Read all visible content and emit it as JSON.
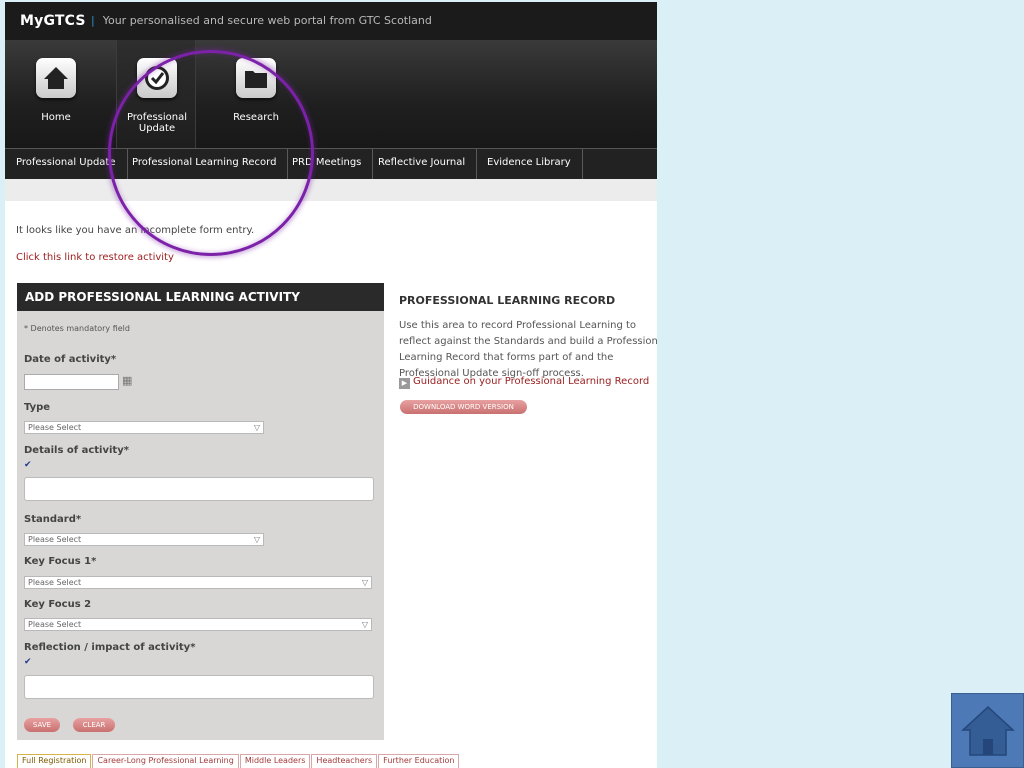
{
  "header": {
    "logo": "MyGTCS",
    "tagline": "Your personalised and secure web portal from GTC Scotland"
  },
  "icon_nav": [
    {
      "label_line1": "Home",
      "label_line2": "",
      "icon": "house-icon"
    },
    {
      "label_line1": "Professional",
      "label_line2": "Update",
      "icon": "check-clock-icon"
    },
    {
      "label_line1": "Research",
      "label_line2": "",
      "icon": "folder-icon"
    }
  ],
  "sub_nav": [
    "Professional Update",
    "Professional Learning Record",
    "PRD Meetings",
    "Reflective Journal",
    "Evidence Library"
  ],
  "notice": "It looks like you have an incomplete form entry.",
  "restore_link": "Click this link to restore activity",
  "form": {
    "title": "ADD PROFESSIONAL LEARNING ACTIVITY",
    "mandatory_note": "* Denotes mandatory field",
    "date_label": "Date of activity*",
    "type_label": "Type",
    "type_value": "Please Select",
    "details_label": "Details of activity*",
    "standard_label": "Standard*",
    "standard_value": "Please Select",
    "key_focus1_label": "Key Focus 1*",
    "key_focus1_value": "Please Select",
    "key_focus2_label": "Key Focus 2",
    "key_focus2_value": "Please Select",
    "reflection_label": "Reflection / impact of activity*",
    "save_label": "SAVE",
    "clear_label": "CLEAR"
  },
  "info": {
    "title": "PROFESSIONAL LEARNING RECORD",
    "text": "Use this area to record Professional Learning to reflect against the Standards and build a Professional Learning Record that forms part of and the Professional Update sign-off process.",
    "guidance_link": "Guidance on your Professional Learning Record",
    "download_label": "DOWNLOAD WORD VERSION"
  },
  "bottom_tabs": [
    "Full Registration",
    "Career-Long Professional Learning",
    "Middle Leaders",
    "Headteachers",
    "Further Education"
  ],
  "colors": {
    "highlight_circle": "#7c22a8",
    "link_red": "#9b1c1c",
    "home_button": "#4d7ab6",
    "background": "#daf0f6"
  }
}
